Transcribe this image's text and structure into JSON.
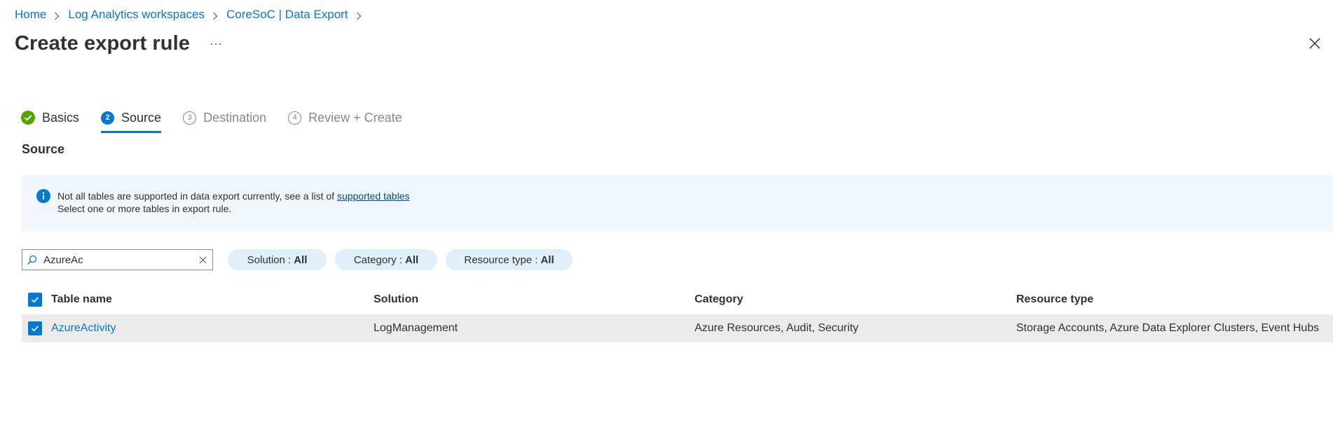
{
  "breadcrumb": [
    {
      "label": "Home"
    },
    {
      "label": "Log Analytics workspaces"
    },
    {
      "label": "CoreSoC | Data Export"
    }
  ],
  "title": "Create export rule",
  "more_label": "···",
  "tabs": [
    {
      "label": "Basics",
      "state": "done",
      "badge": ""
    },
    {
      "label": "Source",
      "state": "active",
      "badge": "2"
    },
    {
      "label": "Destination",
      "state": "pending",
      "badge": "3"
    },
    {
      "label": "Review + Create",
      "state": "pending",
      "badge": "4"
    }
  ],
  "section_title": "Source",
  "banner": {
    "line1_prefix": "Not all tables are supported in data export currently, see a list of ",
    "link": "supported tables",
    "line2": "Select one or more tables in export rule."
  },
  "search": {
    "value": "AzureAc",
    "placeholder": ""
  },
  "filters": [
    {
      "label": "Solution : ",
      "value": "All"
    },
    {
      "label": "Category : ",
      "value": "All"
    },
    {
      "label": "Resource type : ",
      "value": "All"
    }
  ],
  "table": {
    "headers": [
      "Table name",
      "Solution",
      "Category",
      "Resource type"
    ],
    "rows": [
      {
        "name": "AzureActivity",
        "solution": "LogManagement",
        "category": "Azure Resources, Audit, Security",
        "resource": "Storage Accounts, Azure Data Explorer Clusters, Event Hubs"
      }
    ]
  },
  "colors": {
    "accent": "#0078d4",
    "success": "#57a300",
    "banner_bg": "#eff6fc",
    "pill_bg": "#e1effa"
  }
}
